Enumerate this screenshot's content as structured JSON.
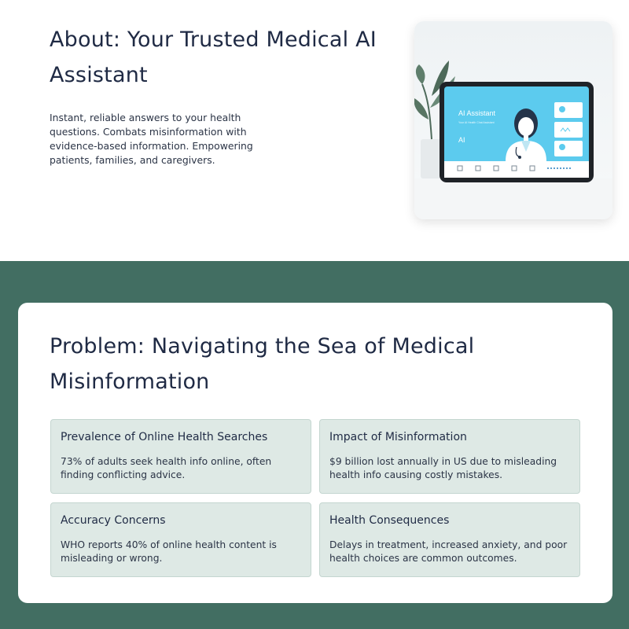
{
  "about": {
    "title": "About: Your Trusted Medical AI Assistant",
    "description": "Instant, reliable answers to your health questions. Combats misinformation with evidence-based information. Empowering patients, families, and caregivers.",
    "image": {
      "screen_title": "AI Assistant",
      "screen_subtitle": "Your AI Health Chat Assistant",
      "badge": "AI"
    }
  },
  "problem": {
    "title": "Problem: Navigating the Sea of Medical Misinformation",
    "cards": [
      {
        "title": "Prevalence of Online Health Searches",
        "text": "73% of adults seek health info online, often finding conflicting advice."
      },
      {
        "title": "Impact of Misinformation",
        "text": "$9 billion lost annually in US due to misleading health info causing costly mistakes."
      },
      {
        "title": "Accuracy Concerns",
        "text": "WHO reports 40% of online health content is misleading or wrong."
      },
      {
        "title": "Health Consequences",
        "text": "Delays in treatment, increased anxiety, and poor health choices are common outcomes."
      }
    ]
  },
  "colors": {
    "band": "#426e62",
    "tile": "#dee9e5",
    "heading": "#1f2a44",
    "screen": "#5ccbee"
  }
}
